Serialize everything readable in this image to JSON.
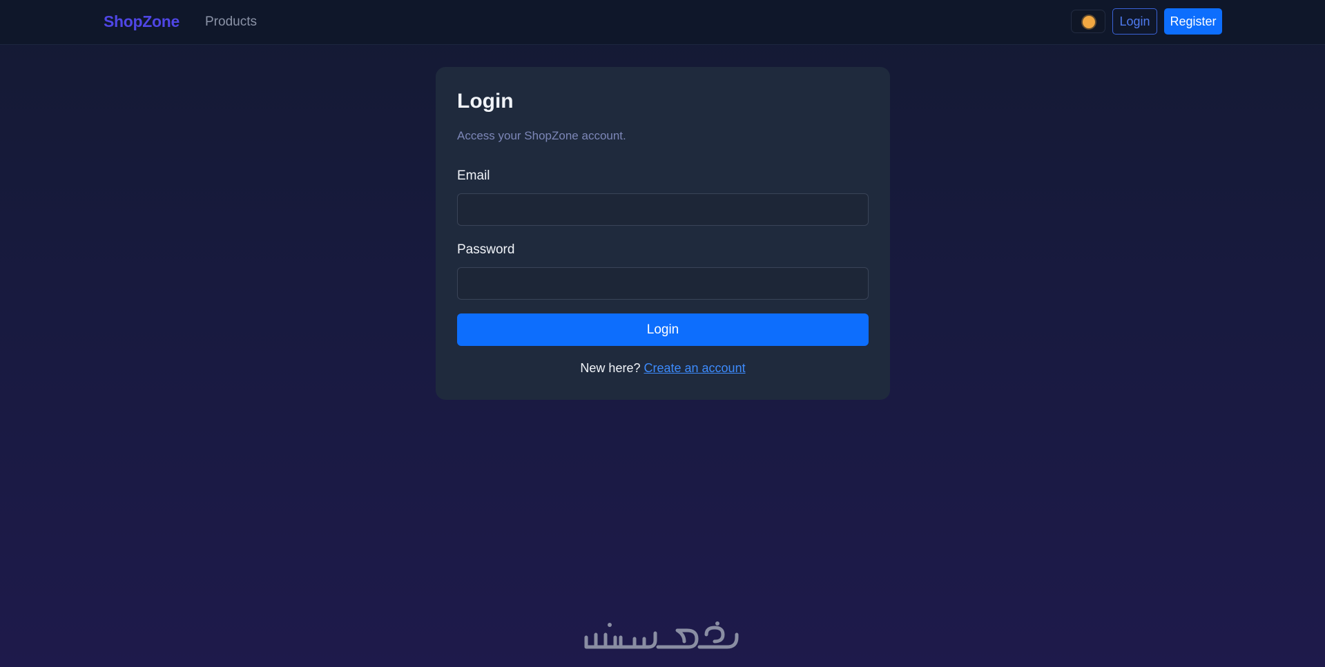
{
  "nav": {
    "brand": "ShopZone",
    "links": [
      "Products"
    ],
    "login_label": "Login",
    "register_label": "Register",
    "theme_icon": "sun-icon"
  },
  "login_card": {
    "title": "Login",
    "subtitle": "Access your ShopZone account.",
    "email_label": "Email",
    "email_value": "",
    "password_label": "Password",
    "password_value": "",
    "submit_label": "Login",
    "signup_prompt": "New here?",
    "signup_link": "Create an account"
  },
  "watermark": {
    "text": "خمسات"
  },
  "colors": {
    "accent": "#0d6efd",
    "brand": "#4f46e5",
    "card_bg": "#1f2a3d",
    "nav_bg": "#0f172a"
  }
}
